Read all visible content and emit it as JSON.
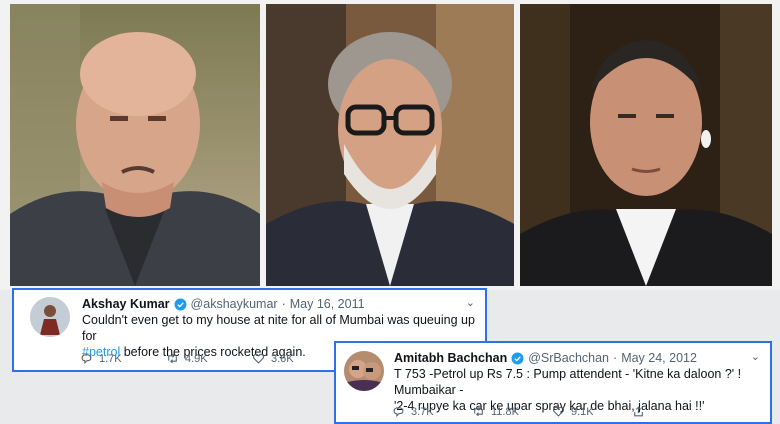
{
  "photos": [
    {
      "subject": "anupam-kher"
    },
    {
      "subject": "amitabh-bachchan"
    },
    {
      "subject": "akshay-kumar"
    }
  ],
  "tweets": [
    {
      "name": "Akshay Kumar",
      "handle": "@akshaykumar",
      "separator": "·",
      "date": "May 16, 2011",
      "text_before_hashtag": "Couldn't even get to my house at nite for all of Mumbai was queuing up for",
      "hashtag": "#petrol",
      "text_after_hashtag": " before the prices rocketed again.",
      "replies": "1.7K",
      "retweets": "4.9K",
      "likes": "3.6K"
    },
    {
      "name": "Amitabh Bachchan",
      "handle": "@SrBachchan",
      "separator": "·",
      "date": "May 24, 2012",
      "text_line_1": "T 753 -Petrol up Rs 7.5 : Pump attendent - 'Kitne ka daloon ?' ! Mumbaikar -",
      "text_line_2": "'2-4 rupye ka car ke upar spray kar de bhai, jalana  hai !!'",
      "replies": "3.7K",
      "retweets": "11.8K",
      "likes": "9.1K"
    }
  ],
  "colors": {
    "highlight_border": "#2f6fea",
    "verified": "#1d9bf0",
    "hashtag": "#1d9bf0",
    "muted_text": "#536471"
  },
  "icons": [
    "verified-badge-icon",
    "more-caret-icon",
    "reply-icon",
    "retweet-icon",
    "like-icon",
    "share-icon"
  ]
}
